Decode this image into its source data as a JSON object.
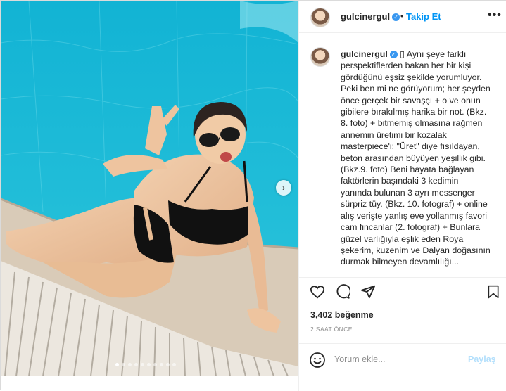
{
  "colors": {
    "pool": "#19b8d6",
    "link_blue": "#0095f6",
    "verified_blue": "#3897f0",
    "muted": "#8e8e8e",
    "share_disabled": "#b2dffc"
  },
  "header": {
    "username": "gulcinergul",
    "separator": "•",
    "follow_label": "Takip Et",
    "more_icon": "ellipsis-icon"
  },
  "caption": {
    "username": "gulcinergul",
    "text": "▯ Aynı şeye farklı\nperspektiflerden bakan her bir kişi\ngördüğünü eşsiz şekilde yorumluyor.\nPeki ben mi ne görüyorum; her şeyden\nönce gerçek bir savaşçı + o ve onun\ngibilere bırakılmış harika bir not. (Bkz.\n8. foto) + bitmemiş olmasına rağmen\nannemin üretimi bir kozalak\nmasterpiece'i: \"Üret\" diye fısıldayan,\nbeton arasından büyüyen yeşillik gibi.\n(Bkz.9. foto) Beni hayata bağlayan\nfaktörlerin başındaki 3 kedimin\nyanında bulunan 3 ayrı messenger\nsürpriz tüy. (Bkz. 10. fotograf) + online\nalış verişte yanlış eve yollanmış favori\ncam fincanlar (2. fotograf) + Bunlara\ngüzel varlığıyla eşlik eden Roya\nşekerim, kuzenim ve Dalyan doğasının\ndurmak bilmeyen devamlılığı..."
  },
  "actions": {
    "icons": [
      "heart-icon",
      "comment-icon",
      "share-icon",
      "bookmark-icon"
    ]
  },
  "likes": "3,402 beğenme",
  "timestamp": "2 SAAT ÖNCE",
  "comment_box": {
    "placeholder": "Yorum ekle...",
    "post_label": "Paylaş",
    "emoji_icon": "smiley-icon"
  },
  "carousel": {
    "next_icon": "chevron-right-icon",
    "dots_total": 10,
    "active_index": 0
  }
}
